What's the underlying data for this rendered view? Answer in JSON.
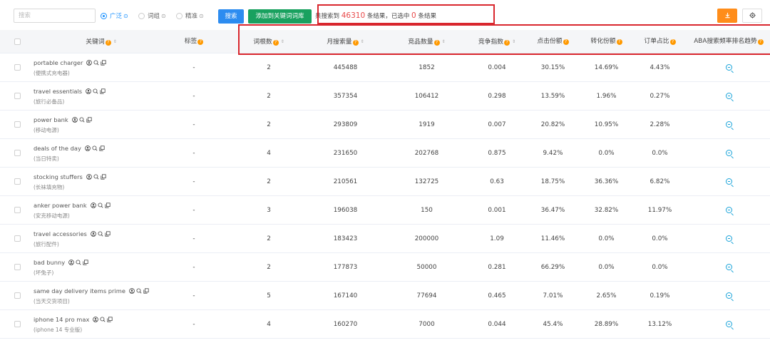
{
  "toolbar": {
    "search_placeholder": "搜索",
    "radios": [
      {
        "label": "广泛",
        "checked": true
      },
      {
        "label": "词组",
        "checked": false
      },
      {
        "label": "精准",
        "checked": false
      }
    ],
    "help_glyph": "⊙",
    "search_button": "搜索",
    "add_button": "添加到关键词词库",
    "summary_prefix": "共搜索到",
    "total_results": "46310",
    "summary_mid": "条结果，已选中",
    "selected_count": "0",
    "summary_suffix": "条结果",
    "export_icon": "download-icon",
    "settings_icon": "gear-icon"
  },
  "colors": {
    "accent_blue": "#2d8cf0",
    "add_green": "#19a15f",
    "export_orange": "#ff8d1a",
    "highlight_red": "#d9272e",
    "help_badge": "#ff9900",
    "trend_icon": "#19a3d9"
  },
  "table": {
    "headers": {
      "keyword": "关键词",
      "tag": "标签",
      "root_count": "词根数",
      "monthly_search": "月搜索量",
      "product_count": "竞品数量",
      "competition": "竞争指数",
      "click_share": "点击份额",
      "conversion_share": "转化份额",
      "order_share": "订单占比",
      "aba_trend": "ABA搜索频率排名趋势"
    },
    "help_badge_text": "?",
    "sort_glyph": "⇕",
    "rows": [
      {
        "keyword": "portable charger",
        "cn": "(便携式充电器)",
        "tag": "-",
        "root": "2",
        "search": "445488",
        "products": "1852",
        "competition": "0.004",
        "click": "30.15%",
        "conversion": "14.69%",
        "order": "4.43%"
      },
      {
        "keyword": "travel essentials",
        "cn": "(旅行必备品)",
        "tag": "-",
        "root": "2",
        "search": "357354",
        "products": "106412",
        "competition": "0.298",
        "click": "13.59%",
        "conversion": "1.96%",
        "order": "0.27%"
      },
      {
        "keyword": "power bank",
        "cn": "(移动电源)",
        "tag": "-",
        "root": "2",
        "search": "293809",
        "products": "1919",
        "competition": "0.007",
        "click": "20.82%",
        "conversion": "10.95%",
        "order": "2.28%"
      },
      {
        "keyword": "deals of the day",
        "cn": "(当日特卖)",
        "tag": "-",
        "root": "4",
        "search": "231650",
        "products": "202768",
        "competition": "0.875",
        "click": "9.42%",
        "conversion": "0.0%",
        "order": "0.0%"
      },
      {
        "keyword": "stocking stuffers",
        "cn": "(长袜填充物)",
        "tag": "-",
        "root": "2",
        "search": "210561",
        "products": "132725",
        "competition": "0.63",
        "click": "18.75%",
        "conversion": "36.36%",
        "order": "6.82%"
      },
      {
        "keyword": "anker power bank",
        "cn": "(安克移动电源)",
        "tag": "-",
        "root": "3",
        "search": "196038",
        "products": "150",
        "competition": "0.001",
        "click": "36.47%",
        "conversion": "32.82%",
        "order": "11.97%"
      },
      {
        "keyword": "travel accessories",
        "cn": "(旅行配件)",
        "tag": "-",
        "root": "2",
        "search": "183423",
        "products": "200000",
        "competition": "1.09",
        "click": "11.46%",
        "conversion": "0.0%",
        "order": "0.0%"
      },
      {
        "keyword": "bad bunny",
        "cn": "(坏兔子)",
        "tag": "-",
        "root": "2",
        "search": "177873",
        "products": "50000",
        "competition": "0.281",
        "click": "66.29%",
        "conversion": "0.0%",
        "order": "0.0%"
      },
      {
        "keyword": "same day delivery items prime",
        "cn": "(当天交货项目)",
        "tag": "-",
        "root": "5",
        "search": "167140",
        "products": "77694",
        "competition": "0.465",
        "click": "7.01%",
        "conversion": "2.65%",
        "order": "0.19%"
      },
      {
        "keyword": "iphone 14 pro max",
        "cn": "(iphone 14 专业版)",
        "tag": "-",
        "root": "4",
        "search": "160270",
        "products": "7000",
        "competition": "0.044",
        "click": "45.4%",
        "conversion": "28.89%",
        "order": "13.12%"
      }
    ],
    "keyword_icons": [
      "user-icon",
      "search-icon",
      "copy-icon"
    ],
    "trend_icon": "zoom-in-icon"
  }
}
